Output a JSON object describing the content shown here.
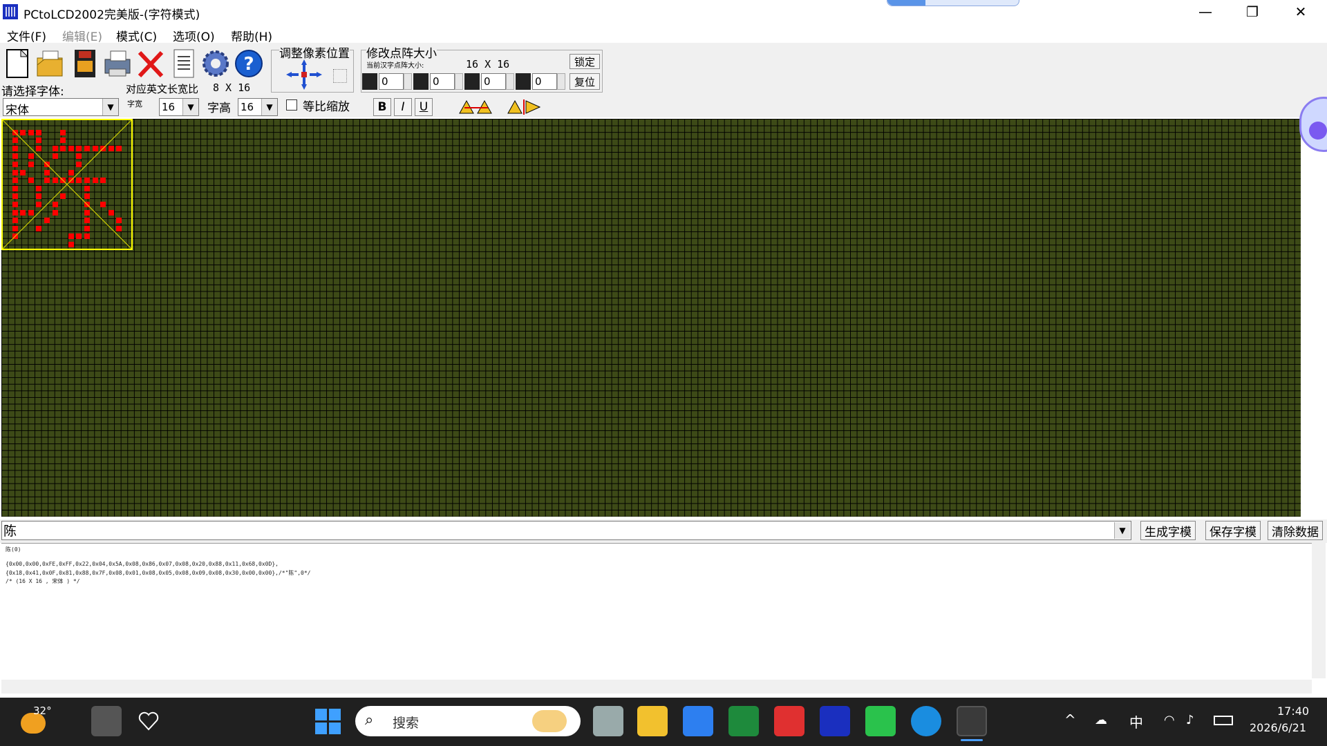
{
  "window": {
    "title": "PCtoLCD2002完美版-(字符模式)",
    "minimize_glyph": "—",
    "maximize_glyph": "❐",
    "close_glyph": "✕"
  },
  "menu": [
    "文件(F)",
    "编辑(E)",
    "模式(C)",
    "选项(O)",
    "帮助(H)"
  ],
  "menu_disabled": [
    false,
    true,
    false,
    false,
    false
  ],
  "toolbar": {
    "icons": [
      "new-icon",
      "open-icon",
      "save-icon",
      "print-icon",
      "delete-icon",
      "notes-icon",
      "settings-icon",
      "help-icon"
    ],
    "font_label": "请选择字体:",
    "font_value": "宋体",
    "ratio_label": "对应英文长宽比",
    "ratio_value": "8 X 16",
    "width_label": "字宽",
    "width_value": "16",
    "height_label": "字高",
    "height_value": "16",
    "scale_label": "等比缩放",
    "bold": "B",
    "italic": "I",
    "underline": "U",
    "pixel_pos_label": "调整像素位置",
    "matrix_label": "修改点阵大小",
    "current_size_label": "当前汉字点阵大小:",
    "current_size_value": "16 X 16",
    "offsets": [
      "0",
      "0",
      "0",
      "0"
    ],
    "lock_button": "锁定",
    "reset_button": "复位"
  },
  "input": {
    "value": "陈",
    "generate_button": "生成字模",
    "save_button": "保存字模",
    "clear_button": "清除数据"
  },
  "output": {
    "lines": [
      "陈(0)",
      "",
      "{0x00,0x00,0xFE,0xFF,0x22,0x04,0x5A,0x08,0x86,0x07,0x08,0x20,0x88,0x11,0x68,0x0D},",
      "{0x18,0x41,0x0F,0x81,0x88,0x7F,0x08,0x01,0x08,0x05,0x08,0x09,0x08,0x30,0x00,0x00},/*\"陈\",0*/",
      "/* (16 X 16 , 宋体 ) */"
    ]
  },
  "glyph_rows": [
    "................",
    ".XXXX..X........",
    ".X..X..X........",
    ".X..X.XXXXXXXXX.",
    ".X.X..X..X......",
    ".X.X.X...X......",
    ".XX..X..X.......",
    ".X.X.XXXXXXXX...",
    ".X..X.....X.....",
    ".X..X..X..X.....",
    ".X..X.X...X.X...",
    ".XXX..X...X..X..",
    ".X...X....X...X.",
    ".X..X.....X...X.",
    ".X......XXX.....",
    "........X......."
  ],
  "taskbar": {
    "weather": "32°",
    "search_placeholder": "搜索",
    "ime": "中",
    "time": "17:40",
    "date": "2026/6/21"
  }
}
